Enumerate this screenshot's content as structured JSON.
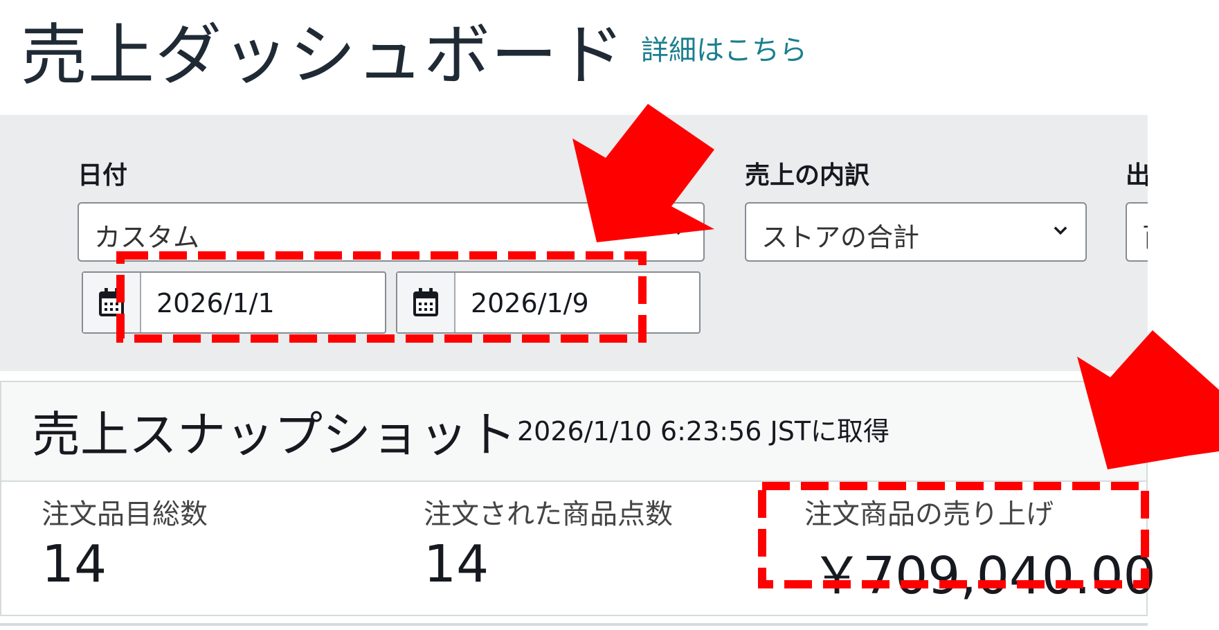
{
  "header": {
    "title": "売上ダッシュボード",
    "detail_link": "詳細はこちら"
  },
  "filters": {
    "date": {
      "label": "日付",
      "range_value": "カスタム",
      "start_date": "2026/1/1",
      "end_date": "2026/1/9"
    },
    "breakdown": {
      "label": "売上の内訳",
      "value": "ストアの合計"
    },
    "shipping": {
      "label": "出",
      "value": "百"
    }
  },
  "snapshot": {
    "title": "売上スナップショット",
    "captured_at": "2026/1/10 6:23:56 JSTに取得",
    "metrics": [
      {
        "label": "注文品目総数",
        "value": "14"
      },
      {
        "label": "注文された商品点数",
        "value": "14"
      },
      {
        "label": "注文商品の売り上げ",
        "value": "￥709,040.00"
      }
    ]
  },
  "colors": {
    "accent_link": "#1a7f8e",
    "panel_bg": "#eaecee",
    "annotation": "#ff0000"
  },
  "icons": [
    "calendar-icon",
    "chevron-down-icon",
    "annotation-arrow"
  ]
}
